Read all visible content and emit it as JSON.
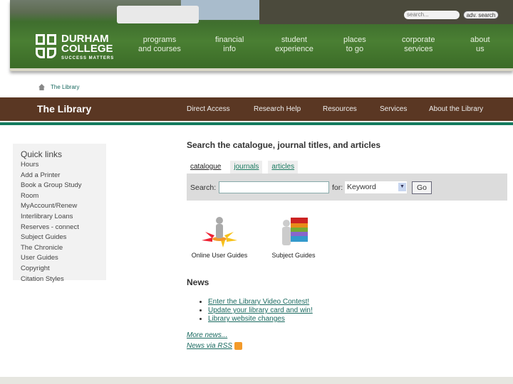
{
  "header": {
    "logo": {
      "line1": "DURHAM",
      "line2": "COLLEGE",
      "tagline": "SUCCESS MATTERS"
    },
    "search_placeholder": "search...",
    "adv_search": "adv. search",
    "nav": [
      {
        "l1": "programs",
        "l2": "and courses"
      },
      {
        "l1": "financial",
        "l2": "info"
      },
      {
        "l1": "student",
        "l2": "experience"
      },
      {
        "l1": "places",
        "l2": "to go"
      },
      {
        "l1": "corporate",
        "l2": "services"
      },
      {
        "l1": "about",
        "l2": "us"
      }
    ]
  },
  "breadcrumb": {
    "current": "The Library"
  },
  "library_bar": {
    "title": "The Library",
    "nav": [
      "Direct Access",
      "Research Help",
      "Resources",
      "Services",
      "About the Library"
    ]
  },
  "quicklinks": {
    "title": "Quick links",
    "items": [
      "Hours",
      "Add a Printer",
      "Book a Group Study Room",
      "MyAccount/Renew",
      "Interlibrary Loans",
      "Reserves - connect",
      "Subject Guides",
      "The Chronicle",
      "User Guides",
      "Copyright",
      "Citation Styles"
    ]
  },
  "search": {
    "heading": "Search the catalogue, journal titles, and articles",
    "tabs": [
      "catalogue",
      "journals",
      "articles"
    ],
    "label": "Search:",
    "value": "",
    "for_label": "for:",
    "select": "Keyword",
    "go": "Go"
  },
  "guides": [
    "Online User Guides",
    "Subject Guides"
  ],
  "news": {
    "title": "News",
    "items": [
      "Enter the Library Video Contest!",
      "Update your library card and win!",
      "Library website changes"
    ],
    "more": "More news...",
    "rss": "News via RSS"
  },
  "colors": {
    "brown": "#5a3723",
    "green": "#137a5e",
    "link": "#1a6a60"
  }
}
